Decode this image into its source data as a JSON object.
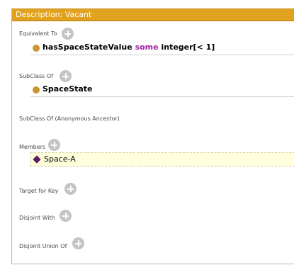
{
  "header": {
    "title": "Description: Vacant"
  },
  "sections": {
    "equivalent_to": {
      "label": "Equivalent To",
      "entry": {
        "property": "hasSpaceStateValue",
        "keyword": "some",
        "filler": "integer[< 1]"
      }
    },
    "subclass_of": {
      "label": "SubClass Of",
      "entry": {
        "text": "SpaceState"
      }
    },
    "subclass_of_anon": {
      "label": "SubClass Of (Anonymous Ancestor)"
    },
    "members": {
      "label": "Members",
      "entry": {
        "text": "Space-A"
      }
    },
    "target_for_key": {
      "label": "Target for Key"
    },
    "disjoint_with": {
      "label": "Disjoint With"
    },
    "disjoint_union_of": {
      "label": "Disjoint Union Of"
    }
  },
  "icons": {
    "add": "add-circle-icon",
    "class": "class-circle-icon",
    "individual": "individual-diamond-icon"
  },
  "colors": {
    "header_bg": "#e0a21f",
    "header_text": "#ffffff",
    "class_icon": "#c8972f",
    "individual_icon": "#5b1a5e",
    "keyword": "#a020a0",
    "add_button": "#c4c4c4",
    "selected_row_bg": "#ffffdc"
  }
}
